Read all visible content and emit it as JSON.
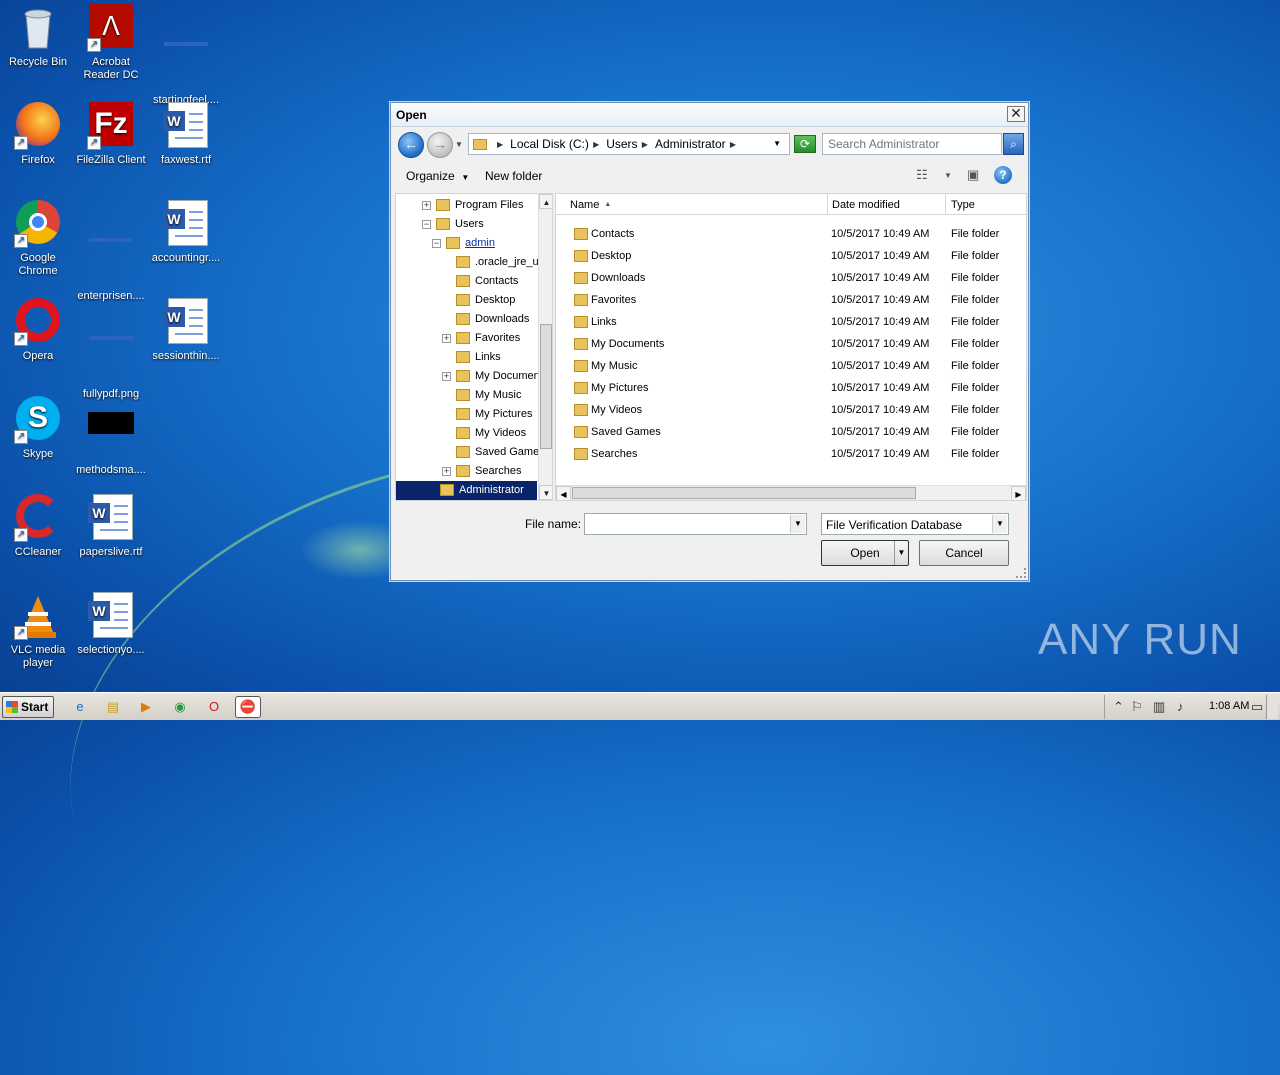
{
  "desktop": {
    "icons": [
      {
        "label": "Recycle Bin",
        "icon": "recycle-bin-icon"
      },
      {
        "label": "Acrobat Reader DC",
        "icon": "acrobat-icon"
      },
      {
        "label": "startingfeel....",
        "icon": "blank-file-icon"
      },
      {
        "label": "Firefox",
        "icon": "firefox-icon"
      },
      {
        "label": "FileZilla Client",
        "icon": "filezilla-icon"
      },
      {
        "label": "faxwest.rtf",
        "icon": "word-doc-icon"
      },
      {
        "label": "Google Chrome",
        "icon": "chrome-icon"
      },
      {
        "label": "enterprisen....",
        "icon": "blank-file-icon"
      },
      {
        "label": "accountingr....",
        "icon": "word-doc-icon"
      },
      {
        "label": "Opera",
        "icon": "opera-icon"
      },
      {
        "label": "fullypdf.png",
        "icon": "blank-file-icon"
      },
      {
        "label": "sessionthin....",
        "icon": "word-doc-icon"
      },
      {
        "label": "Skype",
        "icon": "skype-icon"
      },
      {
        "label": "methodsma....",
        "icon": "black-image-icon"
      },
      {
        "label": "CCleaner",
        "icon": "ccleaner-icon"
      },
      {
        "label": "paperslive.rtf",
        "icon": "word-doc-icon"
      },
      {
        "label": "VLC media player",
        "icon": "vlc-icon"
      },
      {
        "label": "selectionyo....",
        "icon": "word-doc-icon"
      }
    ],
    "watermark": "ANY RUN"
  },
  "dialog": {
    "title": "Open",
    "close_symbol": "✕",
    "address": {
      "crumbs": [
        "Local Disk (C:)",
        "Users",
        "Administrator"
      ]
    },
    "search": {
      "placeholder": "Search Administrator"
    },
    "toolbar": {
      "organize": "Organize",
      "new_folder": "New folder"
    },
    "tree": [
      {
        "label": "Program Files",
        "level": 2,
        "expander": "+",
        "style": ""
      },
      {
        "label": "Users",
        "level": 2,
        "expander": "−",
        "style": ""
      },
      {
        "label": "admin",
        "level": 3,
        "expander": "−",
        "style": "link"
      },
      {
        "label": ".oracle_jre_u",
        "level": 4,
        "expander": "",
        "style": ""
      },
      {
        "label": "Contacts",
        "level": 4,
        "expander": "",
        "style": ""
      },
      {
        "label": "Desktop",
        "level": 4,
        "expander": "",
        "style": ""
      },
      {
        "label": "Downloads",
        "level": 4,
        "expander": "",
        "style": ""
      },
      {
        "label": "Favorites",
        "level": 4,
        "expander": "+",
        "style": ""
      },
      {
        "label": "Links",
        "level": 4,
        "expander": "",
        "style": ""
      },
      {
        "label": "My Documen",
        "level": 4,
        "expander": "+",
        "style": ""
      },
      {
        "label": "My Music",
        "level": 4,
        "expander": "",
        "style": ""
      },
      {
        "label": "My Pictures",
        "level": 4,
        "expander": "",
        "style": ""
      },
      {
        "label": "My Videos",
        "level": 4,
        "expander": "",
        "style": ""
      },
      {
        "label": "Saved Game",
        "level": 4,
        "expander": "",
        "style": ""
      },
      {
        "label": "Searches",
        "level": 4,
        "expander": "+",
        "style": ""
      },
      {
        "label": "Administrator",
        "level": 3,
        "expander": "",
        "style": "sel"
      }
    ],
    "columns": {
      "name": "Name",
      "date": "Date modified",
      "type": "Type"
    },
    "files": [
      {
        "name": "Contacts",
        "date": "10/5/2017 10:49 AM",
        "type": "File folder"
      },
      {
        "name": "Desktop",
        "date": "10/5/2017 10:49 AM",
        "type": "File folder"
      },
      {
        "name": "Downloads",
        "date": "10/5/2017 10:49 AM",
        "type": "File folder"
      },
      {
        "name": "Favorites",
        "date": "10/5/2017 10:49 AM",
        "type": "File folder"
      },
      {
        "name": "Links",
        "date": "10/5/2017 10:49 AM",
        "type": "File folder"
      },
      {
        "name": "My Documents",
        "date": "10/5/2017 10:49 AM",
        "type": "File folder"
      },
      {
        "name": "My Music",
        "date": "10/5/2017 10:49 AM",
        "type": "File folder"
      },
      {
        "name": "My Pictures",
        "date": "10/5/2017 10:49 AM",
        "type": "File folder"
      },
      {
        "name": "My Videos",
        "date": "10/5/2017 10:49 AM",
        "type": "File folder"
      },
      {
        "name": "Saved Games",
        "date": "10/5/2017 10:49 AM",
        "type": "File folder"
      },
      {
        "name": "Searches",
        "date": "10/5/2017 10:49 AM",
        "type": "File folder"
      }
    ],
    "file_name_label": "File name:",
    "file_name_value": "",
    "filter_value": "File Verification Database",
    "open_label": "Open",
    "cancel_label": "Cancel"
  },
  "taskbar": {
    "start_label": "Start",
    "apps": [
      "internet-explorer-icon",
      "explorer-icon",
      "media-player-icon",
      "chrome-icon",
      "opera-icon",
      "active-app-icon"
    ],
    "clock": "1:08 AM"
  },
  "colors": {
    "selection": "#0a246a",
    "folder": "#e8c25a",
    "link": "#0a30a8"
  }
}
